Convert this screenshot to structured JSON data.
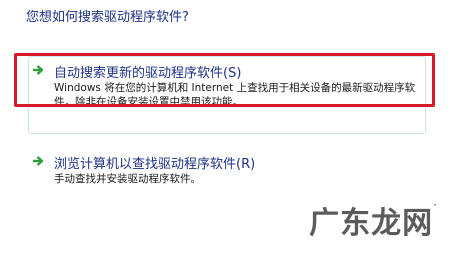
{
  "dialog": {
    "question": "您想如何搜索驱动程序软件?"
  },
  "options": [
    {
      "icon": "green-arrow-icon",
      "title": "自动搜索更新的驱动程序软件(S)",
      "description": "Windows 将在您的计算机和 Internet 上查找用于相关设备的最新驱动程序软件，除非在设备安装设置中禁用该功能。"
    },
    {
      "icon": "green-arrow-icon",
      "title": "浏览计算机以查找驱动程序软件(R)",
      "description": "手动查找并安装驱动程序软件。"
    }
  ],
  "watermark": {
    "text": "广东龙网",
    "mark": "·"
  },
  "colors": {
    "title_blue": "#1e3287",
    "highlight_red": "#d8182b",
    "arrow_green": "#2e9e3a",
    "card_border": "#c9e3f0"
  }
}
